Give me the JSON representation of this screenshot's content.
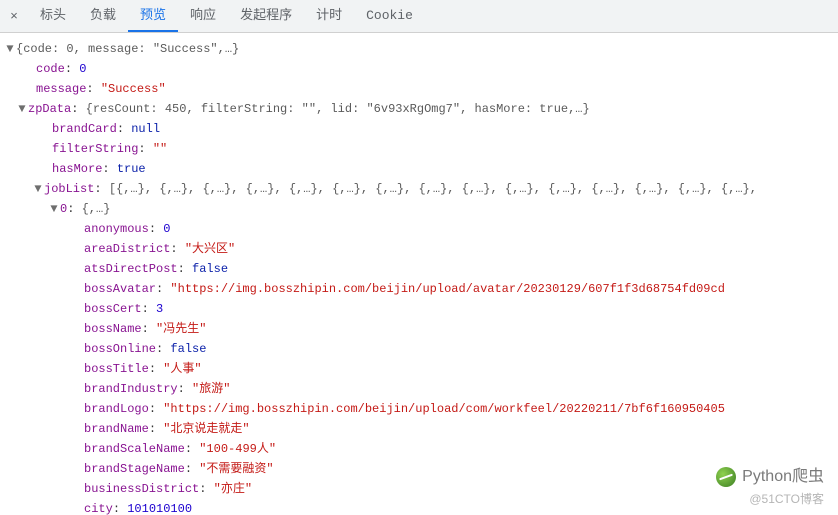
{
  "tabs": {
    "close": "×",
    "items": [
      "标头",
      "负载",
      "预览",
      "响应",
      "发起程序",
      "计时",
      "Cookie"
    ],
    "active_index": 2
  },
  "tree": {
    "root_summary_open": "{code: 0, message: \"Success\",…}",
    "code_k": "code",
    "code_v": "0",
    "message_k": "message",
    "message_v": "\"Success\"",
    "zp_k": "zpData",
    "zp_summary": "{resCount: 450, filterString: \"\", lid: \"6v93xRgOmg7\", hasMore: true,…}",
    "brandCard_k": "brandCard",
    "brandCard_v": "null",
    "filterString_k": "filterString",
    "filterString_v": "\"\"",
    "hasMore_k": "hasMore",
    "hasMore_v": "true",
    "jobList_k": "jobList",
    "jobList_summary": "[{,…}, {,…}, {,…}, {,…}, {,…}, {,…}, {,…}, {,…}, {,…}, {,…}, {,…}, {,…}, {,…}, {,…}, {,…},",
    "idx0_k": "0",
    "idx0_summary": "{,…}",
    "fields": {
      "anonymous": {
        "k": "anonymous",
        "v": "0",
        "t": "n"
      },
      "areaDistrict": {
        "k": "areaDistrict",
        "v": "\"大兴区\"",
        "t": "s"
      },
      "atsDirectPost": {
        "k": "atsDirectPost",
        "v": "false",
        "t": "b"
      },
      "bossAvatar": {
        "k": "bossAvatar",
        "v": "\"https://img.bosszhipin.com/beijin/upload/avatar/20230129/607f1f3d68754fd09cd",
        "t": "s"
      },
      "bossCert": {
        "k": "bossCert",
        "v": "3",
        "t": "n"
      },
      "bossName": {
        "k": "bossName",
        "v": "\"冯先生\"",
        "t": "s"
      },
      "bossOnline": {
        "k": "bossOnline",
        "v": "false",
        "t": "b"
      },
      "bossTitle": {
        "k": "bossTitle",
        "v": "\"人事\"",
        "t": "s"
      },
      "brandIndustry": {
        "k": "brandIndustry",
        "v": "\"旅游\"",
        "t": "s"
      },
      "brandLogo": {
        "k": "brandLogo",
        "v": "\"https://img.bosszhipin.com/beijin/upload/com/workfeel/20220211/7bf6f160950405",
        "t": "s"
      },
      "brandName": {
        "k": "brandName",
        "v": "\"北京说走就走\"",
        "t": "s"
      },
      "brandScaleName": {
        "k": "brandScaleName",
        "v": "\"100-499人\"",
        "t": "s"
      },
      "brandStageName": {
        "k": "brandStageName",
        "v": "\"不需要融资\"",
        "t": "s"
      },
      "businessDistrict": {
        "k": "businessDistrict",
        "v": "\"亦庄\"",
        "t": "s"
      },
      "city": {
        "k": "city",
        "v": "101010100",
        "t": "n"
      }
    }
  },
  "watermark": {
    "line1": "Python爬虫",
    "line2": "@51CTO博客"
  }
}
